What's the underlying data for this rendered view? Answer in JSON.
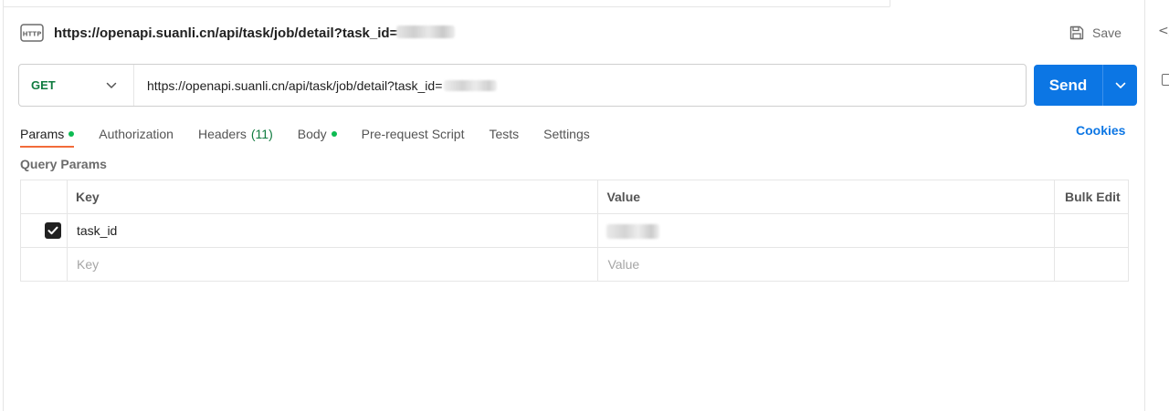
{
  "request": {
    "title": "https://openapi.suanli.cn/api/task/job/detail?task_id=",
    "save_label": "Save"
  },
  "url_bar": {
    "method": "GET",
    "url": "https://openapi.suanli.cn/api/task/job/detail?task_id="
  },
  "send": {
    "label": "Send"
  },
  "tabs": [
    {
      "label": "Params",
      "dot": true,
      "active": true
    },
    {
      "label": "Authorization"
    },
    {
      "label": "Headers",
      "count": "(11)"
    },
    {
      "label": "Body",
      "dot": true
    },
    {
      "label": "Pre-request Script"
    },
    {
      "label": "Tests"
    },
    {
      "label": "Settings"
    }
  ],
  "cookies_label": "Cookies",
  "query_params": {
    "title": "Query Params",
    "headers": {
      "key": "Key",
      "value": "Value",
      "bulk_edit": "Bulk Edit"
    },
    "rows": [
      {
        "checked": true,
        "key": "task_id"
      }
    ],
    "placeholder": {
      "key": "Key",
      "value": "Value"
    }
  },
  "colors": {
    "accent": "#0c76e4",
    "method_get": "#0f7b3f",
    "active_tab_underline": "#f26b3a",
    "status_dot": "#0cbb52"
  },
  "icons": {
    "request_type": "http-icon",
    "save": "save-icon",
    "method_dropdown": "chevron-down-icon",
    "send_dropdown": "chevron-down-icon",
    "checkbox": "checkmark-icon",
    "rail_top": "code-icon",
    "rail_second": "document-icon"
  }
}
